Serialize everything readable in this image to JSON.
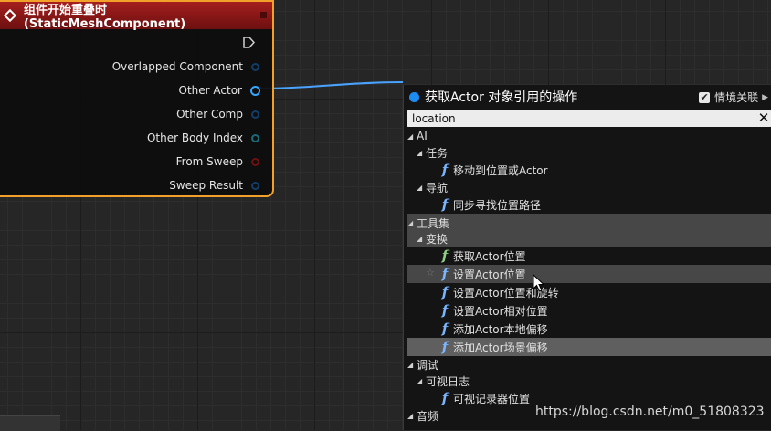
{
  "node": {
    "title": "组件开始重叠时 (StaticMeshComponent)",
    "pins": [
      {
        "label": "Overlapped Component",
        "pin_color": "navy"
      },
      {
        "label": "Other Actor",
        "pin_color": "active"
      },
      {
        "label": "Other Comp",
        "pin_color": "navy"
      },
      {
        "label": "Other Body Index",
        "pin_color": "sea"
      },
      {
        "label": "From Sweep",
        "pin_color": "red"
      },
      {
        "label": "Sweep Result",
        "pin_color": "navy"
      }
    ]
  },
  "menu": {
    "title": "获取Actor 对象引用的操作",
    "context_sensitive_label": "情境关联",
    "context_sensitive_checked": true,
    "search_value": "location",
    "items": [
      {
        "type": "category",
        "label": "AI"
      },
      {
        "type": "subcategory",
        "label": "任务"
      },
      {
        "type": "function",
        "label": "移动到位置或Actor"
      },
      {
        "type": "subcategory",
        "label": "导航"
      },
      {
        "type": "function",
        "label": "同步寻找位置路径"
      },
      {
        "type": "category",
        "label": "工具集"
      },
      {
        "type": "subcategory",
        "label": "变换"
      },
      {
        "type": "function",
        "label": "获取Actor位置"
      },
      {
        "type": "function",
        "label": "设置Actor位置"
      },
      {
        "type": "function",
        "label": "设置Actor位置和旋转"
      },
      {
        "type": "function",
        "label": "设置Actor相对位置"
      },
      {
        "type": "function",
        "label": "添加Actor本地偏移"
      },
      {
        "type": "function",
        "label": "添加Actor场景偏移"
      },
      {
        "type": "category",
        "label": "调试"
      },
      {
        "type": "subcategory",
        "label": "可视日志"
      },
      {
        "type": "function",
        "label": "可视记录器位置"
      },
      {
        "type": "category",
        "label": "音频"
      }
    ]
  },
  "watermark": "https://blog.csdn.net/m0_51808323",
  "colors": {
    "node_border": "#f1a02a",
    "node_header": "#a51e1e",
    "wire": "#4aa3ff",
    "accent": "#1d8cf0",
    "row_highlight": "#474747",
    "row_selected": "#5f5f5f"
  }
}
